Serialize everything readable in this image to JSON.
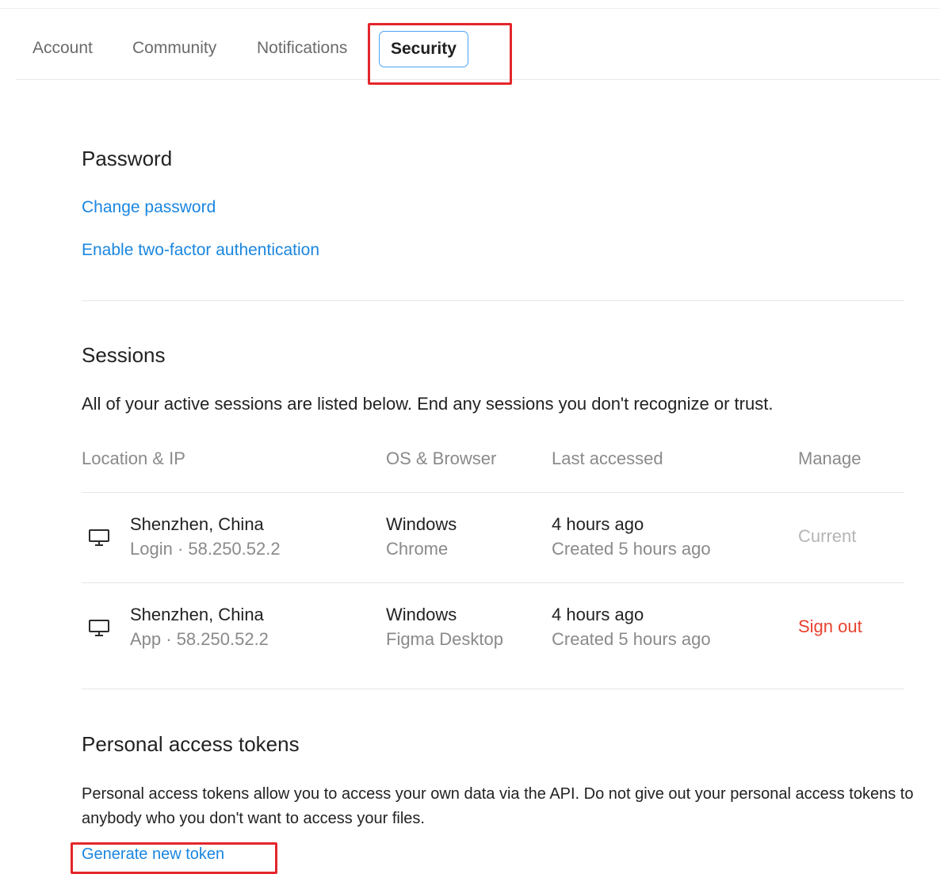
{
  "tabs": {
    "account": "Account",
    "community": "Community",
    "notifications": "Notifications",
    "security": "Security"
  },
  "password": {
    "title": "Password",
    "change_password": "Change password",
    "enable_2fa": "Enable two-factor authentication"
  },
  "sessions": {
    "title": "Sessions",
    "description": "All of your active sessions are listed below. End any sessions you don't recognize or trust.",
    "columns": {
      "location": "Location & IP",
      "os_browser": "OS & Browser",
      "last_accessed": "Last accessed",
      "manage": "Manage"
    },
    "rows": [
      {
        "location": "Shenzhen, China",
        "detail": "Login · 58.250.52.2",
        "os": "Windows",
        "browser": "Chrome",
        "last_accessed": "4 hours ago",
        "created": "Created 5 hours ago",
        "manage": "Current"
      },
      {
        "location": "Shenzhen, China",
        "detail": "App · 58.250.52.2",
        "os": "Windows",
        "browser": "Figma Desktop",
        "last_accessed": "4 hours ago",
        "created": "Created 5 hours ago",
        "manage": "Sign out"
      }
    ]
  },
  "tokens": {
    "title": "Personal access tokens",
    "description": "Personal access tokens allow you to access your own data via the API. Do not give out your personal access tokens to anybody who you don't want to access your files.",
    "generate": "Generate new token"
  },
  "colors": {
    "link": "#1a86e0",
    "danger": "#e8412f",
    "highlight": "#e3262b",
    "active_tab_border": "#4aa3f0"
  },
  "icons": {
    "device": "monitor-icon"
  }
}
